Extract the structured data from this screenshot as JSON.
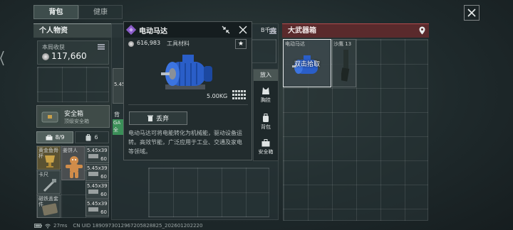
{
  "tabs": {
    "backpack": "背包",
    "health": "健康"
  },
  "personal": {
    "title": "个人物资",
    "income_label": "本局收获",
    "income_value": "117,660",
    "secure_title": "安全箱",
    "secure_sub": "顶级安全箱",
    "count_a": "8/9",
    "count_b": "6",
    "items": [
      {
        "label": "黄金鱼骨杯"
      },
      {
        "label": "姜饼人"
      },
      {
        "label": "卡尺"
      },
      {
        "label": "磁铁盖套件"
      }
    ],
    "ammo": [
      {
        "label": "5.45x39",
        "count": "60"
      },
      {
        "label": "5.45x39",
        "count": "60"
      },
      {
        "label": "5.45x39",
        "count": "60"
      },
      {
        "label": "5.45x39",
        "count": "60"
      }
    ]
  },
  "popup": {
    "title": "电动马达",
    "price": "616,983",
    "category": "工具材料",
    "weight": "5.00KG",
    "discard_label": "丢弃",
    "description": "电动马达可将电能转化为机械能，驱动设备运转。高效节能，广泛应用于工业、交通及家电等领域。",
    "put_in": "放入",
    "chest_rig": "胸挂",
    "backpack": "背包",
    "safe_box": "安全箱"
  },
  "middle": {
    "label_b_pre": "B",
    "label_b_text": "千克",
    "mid_label": "背",
    "mid_item": "5.45",
    "mid_green": "GA",
    "mid_green2": "全"
  },
  "arsenal": {
    "title": "大武器箱",
    "slot1_name": "电动马达",
    "slot1_action": "双击拾取",
    "slot2_name": "沙鹰 13"
  },
  "status": {
    "ping": "27ms",
    "uid": "CN UID 1890973012967205828825_202601202220"
  },
  "colors": {
    "arsenal_header": "#5a2a2c",
    "rarity_purple": "#8a5cc8",
    "accent_green": "#3b8f58"
  }
}
